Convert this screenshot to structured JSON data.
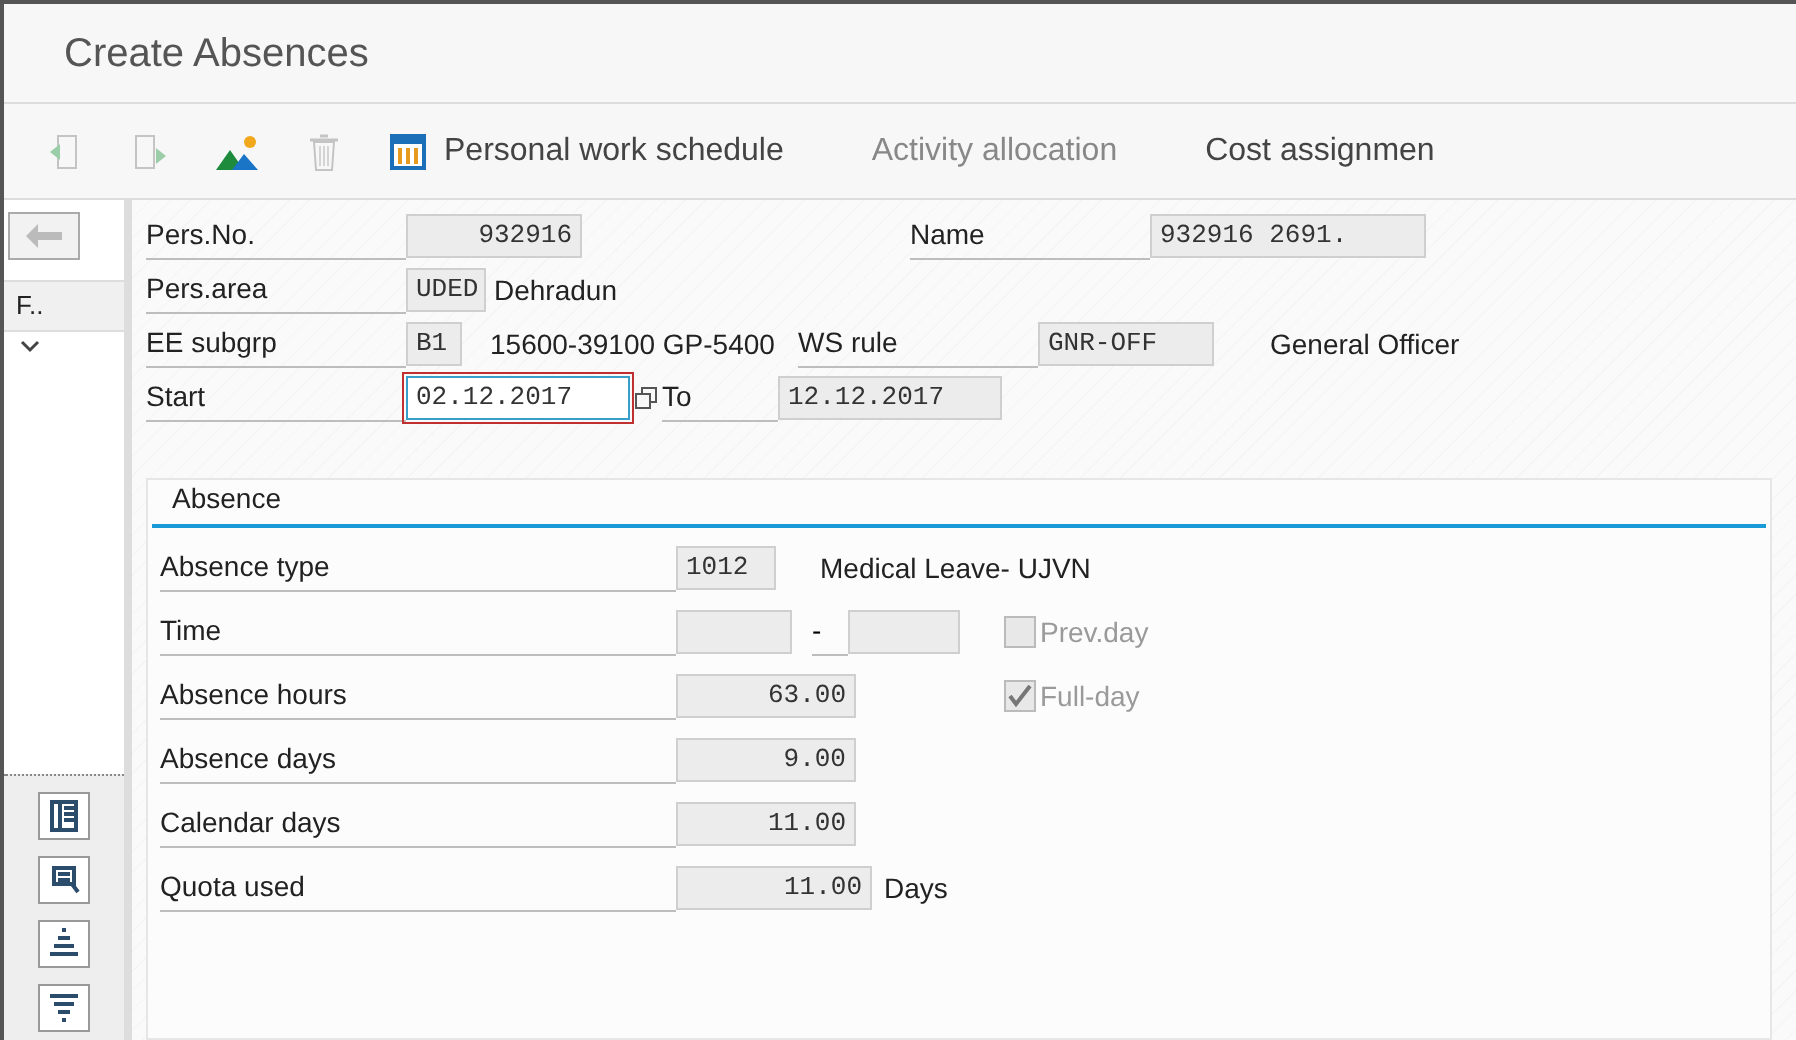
{
  "window": {
    "title": "Create Absences"
  },
  "toolbar": [
    {
      "kind": "icon",
      "disabled": true
    },
    {
      "kind": "icon",
      "disabled": true
    },
    {
      "kind": "icon",
      "disabled": false
    },
    {
      "kind": "icon",
      "disabled": true
    },
    {
      "kind": "labeled",
      "label": "Personal work schedule",
      "disabled": false
    },
    {
      "kind": "text",
      "label": "Activity allocation",
      "disabled": true
    },
    {
      "kind": "text",
      "label": "Cost assignmen",
      "disabled": false
    }
  ],
  "sidebar": {
    "header": "F.."
  },
  "header": {
    "pers_no": {
      "label": "Pers.No.",
      "value": "932916"
    },
    "name": {
      "label": "Name",
      "value": "932916 2691."
    },
    "pers_area": {
      "label": "Pers.area",
      "code": "UDED",
      "text": "Dehradun"
    },
    "ee_subgrp": {
      "label": "EE subgrp",
      "code": "B1",
      "text": "15600-39100 GP-5400"
    },
    "ws_rule": {
      "label": "WS rule",
      "code": "GNR-OFF",
      "text": "General Officer"
    },
    "start": {
      "label": "Start",
      "value": "02.12.2017",
      "focused": true
    },
    "to": {
      "label": "To",
      "value": "12.12.2017"
    }
  },
  "absence": {
    "title": "Absence",
    "type": {
      "label": "Absence type",
      "code": "1012",
      "text": "Medical Leave- UJVN"
    },
    "time": {
      "label": "Time",
      "separator": "-"
    },
    "checkboxes": [
      {
        "label": "Prev.day",
        "checked": false,
        "disabled": true
      },
      {
        "label": "Full-day",
        "checked": true,
        "disabled": true
      }
    ],
    "values": [
      {
        "label": "Absence hours",
        "value": "63.00"
      },
      {
        "label": "Absence days",
        "value": "9.00"
      },
      {
        "label": "Calendar days",
        "value": "11.00"
      },
      {
        "label": "Quota used",
        "value": "11.00",
        "unit": "Days"
      }
    ]
  }
}
